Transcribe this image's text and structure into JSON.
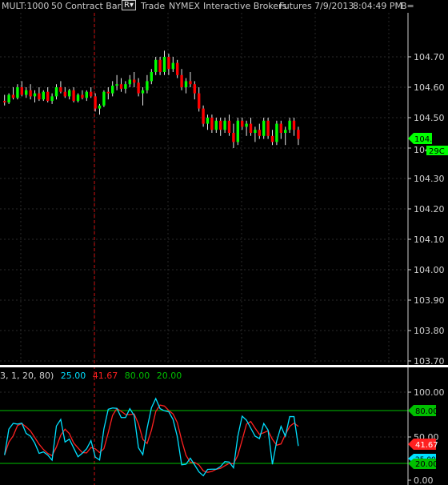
{
  "header": {
    "symbol": "MULT:1000",
    "bar_type": "50 Contract Bars",
    "r_button": "R▾",
    "data_type": "Trade",
    "exchange": "NYMEX",
    "provider": "Interactive Brokers",
    "category": "Futures",
    "date": "7/9/2013",
    "time": "8:04:49 PM",
    "extra": "B="
  },
  "price_axis": {
    "ticks": [
      "104.70",
      "104.60",
      "104.50",
      "104.40",
      "104.30",
      "104.20",
      "104.10",
      "104.00",
      "103.90",
      "103.80",
      "103.70"
    ],
    "last_price": "104.43",
    "countdown": "29C",
    "tick_visible_under_tag": "104"
  },
  "indicator": {
    "params_prefix": "3,  1,  20,  80)",
    "fast_value": "25.00",
    "slow_value": "41.67",
    "upper_level": "80.00",
    "lower_level": "20.00",
    "axis_ticks": [
      "100.00",
      "50.00",
      "0.00"
    ],
    "tag_upper": "80.00",
    "tag_slow": "41.67",
    "tag_fast": "25.00",
    "tag_lower": "20.00",
    "colors": {
      "fast": "#00e0ff",
      "slow": "#ff2020",
      "level": "#00c000"
    }
  },
  "chart_data": {
    "type": "candlestick",
    "price_axis_range": [
      103.7,
      104.7
    ],
    "up_color": "#00ff00",
    "down_color": "#ff0000",
    "candles": [
      [
        104.555,
        104.575,
        104.54,
        104.55
      ],
      [
        104.55,
        104.58,
        104.545,
        104.575
      ],
      [
        104.575,
        104.6,
        104.56,
        104.565
      ],
      [
        104.565,
        104.61,
        104.56,
        104.6
      ],
      [
        104.6,
        104.62,
        104.57,
        104.575
      ],
      [
        104.575,
        104.6,
        104.565,
        104.59
      ],
      [
        104.59,
        104.61,
        104.56,
        104.57
      ],
      [
        104.57,
        104.59,
        104.55,
        104.58
      ],
      [
        104.58,
        104.6,
        104.555,
        104.56
      ],
      [
        104.56,
        104.59,
        104.555,
        104.585
      ],
      [
        104.585,
        104.6,
        104.55,
        104.555
      ],
      [
        104.555,
        104.58,
        104.545,
        104.57
      ],
      [
        104.57,
        104.61,
        104.56,
        104.6
      ],
      [
        104.6,
        104.62,
        104.58,
        104.585
      ],
      [
        104.585,
        104.6,
        104.565,
        104.57
      ],
      [
        104.57,
        104.595,
        104.56,
        104.59
      ],
      [
        104.59,
        104.6,
        104.55,
        104.555
      ],
      [
        104.555,
        104.58,
        104.55,
        104.575
      ],
      [
        104.575,
        104.59,
        104.56,
        104.565
      ],
      [
        104.565,
        104.59,
        104.555,
        104.585
      ],
      [
        104.585,
        104.6,
        104.565,
        104.57
      ],
      [
        104.57,
        104.58,
        104.52,
        104.53
      ],
      [
        104.53,
        104.545,
        104.51,
        104.54
      ],
      [
        104.54,
        104.59,
        104.535,
        104.585
      ],
      [
        104.585,
        104.6,
        104.56,
        104.58
      ],
      [
        104.58,
        104.62,
        104.57,
        104.605
      ],
      [
        104.605,
        104.64,
        104.59,
        104.61
      ],
      [
        104.61,
        104.63,
        104.585,
        104.595
      ],
      [
        104.595,
        104.62,
        104.58,
        104.61
      ],
      [
        104.61,
        104.64,
        104.6,
        104.625
      ],
      [
        104.625,
        104.65,
        104.6,
        104.615
      ],
      [
        104.615,
        104.63,
        104.57,
        104.58
      ],
      [
        104.58,
        104.6,
        104.54,
        104.59
      ],
      [
        104.59,
        104.64,
        104.58,
        104.62
      ],
      [
        104.62,
        104.66,
        104.61,
        104.65
      ],
      [
        104.65,
        104.7,
        104.64,
        104.69
      ],
      [
        104.69,
        104.7,
        104.64,
        104.65
      ],
      [
        104.65,
        104.72,
        104.64,
        104.7
      ],
      [
        104.7,
        104.71,
        104.64,
        104.66
      ],
      [
        104.66,
        104.7,
        104.65,
        104.68
      ],
      [
        104.68,
        104.69,
        104.63,
        104.64
      ],
      [
        104.64,
        104.66,
        104.59,
        104.6
      ],
      [
        104.6,
        104.63,
        104.58,
        104.62
      ],
      [
        104.62,
        104.65,
        104.6,
        104.61
      ],
      [
        104.61,
        104.62,
        104.56,
        104.58
      ],
      [
        104.58,
        104.6,
        104.52,
        104.53
      ],
      [
        104.53,
        104.54,
        104.47,
        104.48
      ],
      [
        104.48,
        104.51,
        104.46,
        104.5
      ],
      [
        104.5,
        104.51,
        104.45,
        104.46
      ],
      [
        104.46,
        104.5,
        104.45,
        104.49
      ],
      [
        104.49,
        104.5,
        104.44,
        104.46
      ],
      [
        104.46,
        104.5,
        104.45,
        104.49
      ],
      [
        104.49,
        104.51,
        104.44,
        104.45
      ],
      [
        104.45,
        104.48,
        104.4,
        104.42
      ],
      [
        104.42,
        104.5,
        104.41,
        104.49
      ],
      [
        104.49,
        104.5,
        104.46,
        104.47
      ],
      [
        104.47,
        104.49,
        104.44,
        104.48
      ],
      [
        104.48,
        104.5,
        104.44,
        104.45
      ],
      [
        104.45,
        104.47,
        104.42,
        104.46
      ],
      [
        104.46,
        104.48,
        104.43,
        104.44
      ],
      [
        104.44,
        104.5,
        104.43,
        104.49
      ],
      [
        104.49,
        104.5,
        104.43,
        104.44
      ],
      [
        104.44,
        104.46,
        104.41,
        104.42
      ],
      [
        104.42,
        104.49,
        104.41,
        104.48
      ],
      [
        104.48,
        104.49,
        104.43,
        104.45
      ],
      [
        104.45,
        104.47,
        104.41,
        104.46
      ],
      [
        104.46,
        104.5,
        104.45,
        104.49
      ],
      [
        104.49,
        104.5,
        104.44,
        104.46
      ],
      [
        104.46,
        104.47,
        104.41,
        104.43
      ]
    ]
  }
}
